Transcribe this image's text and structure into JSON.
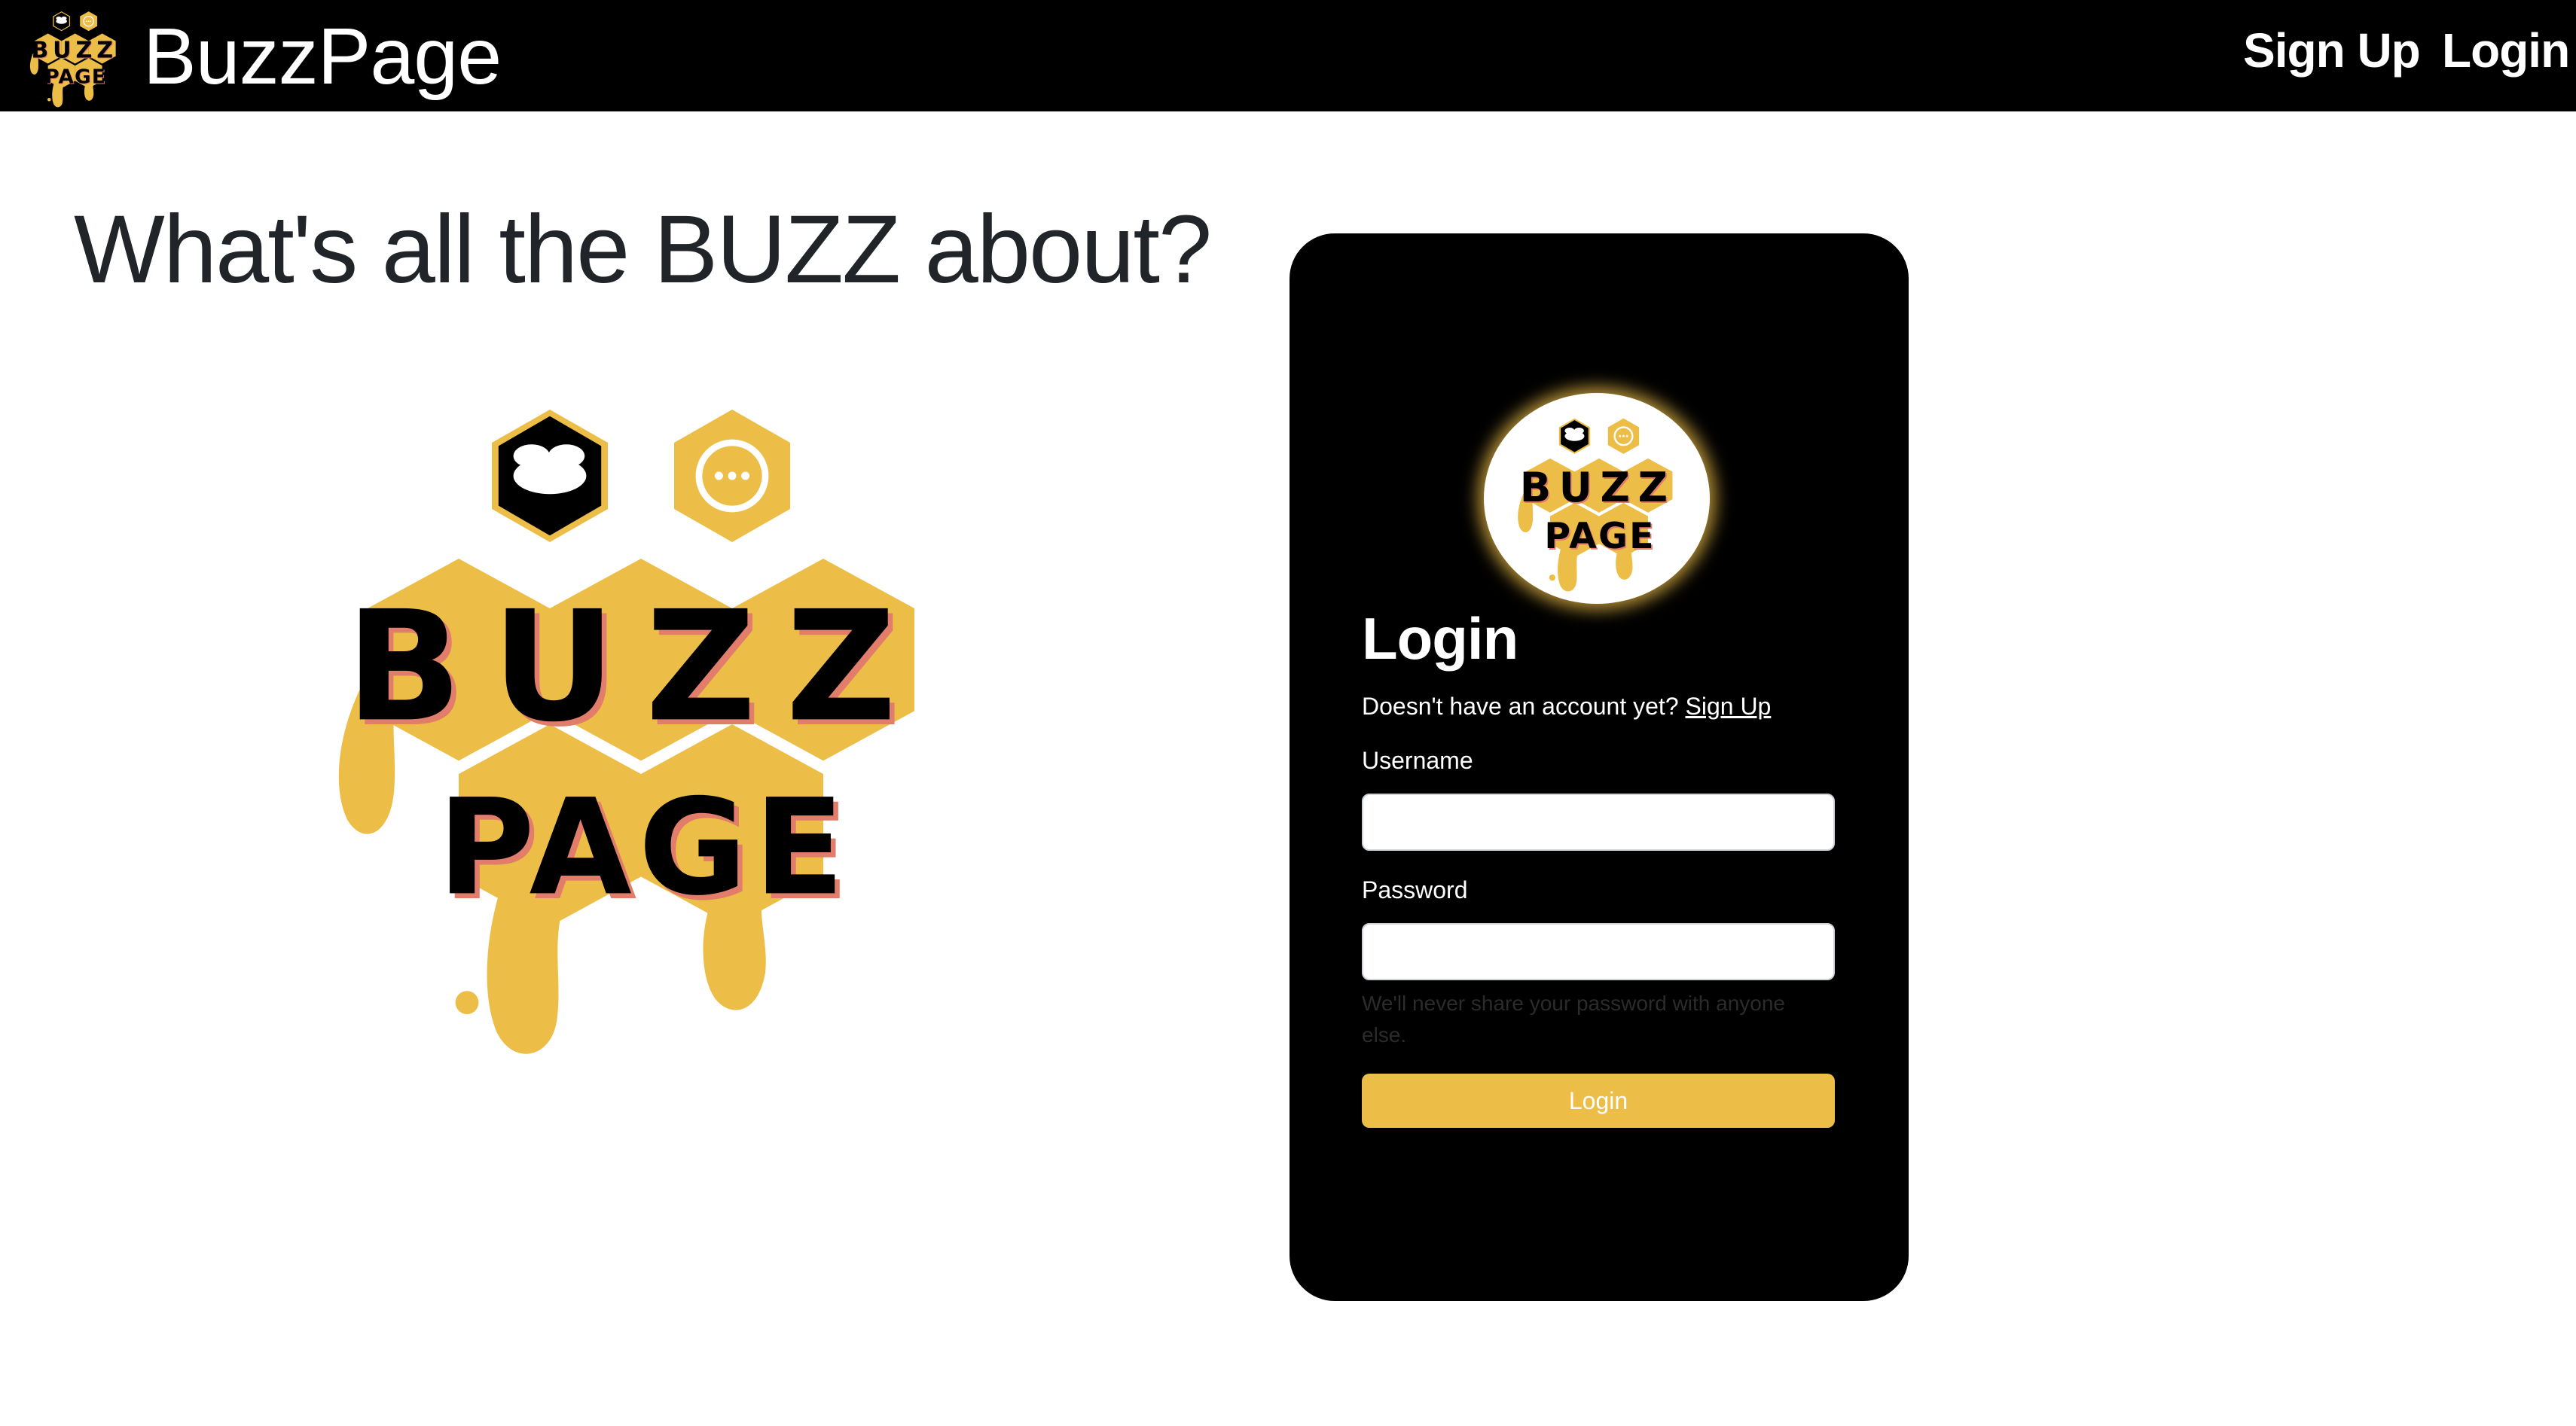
{
  "nav": {
    "brand": "BuzzPage",
    "links": [
      {
        "label": "Sign Up"
      },
      {
        "label": "Login"
      }
    ],
    "logo_icon": "buzzpage-logo-icon"
  },
  "hero": {
    "headline": "What's all the BUZZ about?",
    "logo_icon": "buzzpage-hero-logo"
  },
  "login_card": {
    "title": "Login",
    "subtitle_prefix": "Doesn't have an account yet?",
    "signup_link": "Sign Up",
    "username_label": "Username",
    "username_value": "",
    "password_label": "Password",
    "password_value": "",
    "password_help": "We'll never share your password with anyone else.",
    "submit_label": "Login"
  },
  "colors": {
    "nav_bg": "#000000",
    "honey": "#ecbe48",
    "card_bg": "#000000",
    "text_dark": "#212529"
  }
}
